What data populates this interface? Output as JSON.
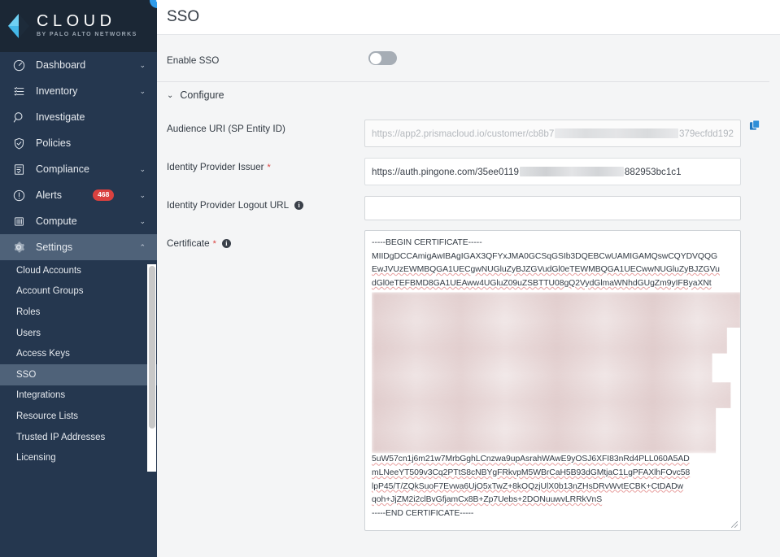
{
  "brand": {
    "word": "CLOUD",
    "tagline": "BY PALO ALTO NETWORKS",
    "logo_color": "#44b8e8",
    "sidebar_bg": "#25374f",
    "active_bg": "#4f6279"
  },
  "sidebar": {
    "collapse_icon": "chevron-left-icon",
    "items": [
      {
        "label": "Dashboard",
        "icon": "gauge-icon",
        "chevron": "⌄",
        "badge": null,
        "active": false
      },
      {
        "label": "Inventory",
        "icon": "list-icon",
        "chevron": "⌄",
        "badge": null,
        "active": false
      },
      {
        "label": "Investigate",
        "icon": "search-icon",
        "chevron": "",
        "badge": null,
        "active": false
      },
      {
        "label": "Policies",
        "icon": "shield-icon",
        "chevron": "",
        "badge": null,
        "active": false
      },
      {
        "label": "Compliance",
        "icon": "clipboard-icon",
        "chevron": "⌄",
        "badge": null,
        "active": false
      },
      {
        "label": "Alerts",
        "icon": "alert-icon",
        "chevron": "⌄",
        "badge": "468",
        "active": false
      },
      {
        "label": "Compute",
        "icon": "container-icon",
        "chevron": "⌄",
        "badge": null,
        "active": false
      },
      {
        "label": "Settings",
        "icon": "gear-icon",
        "chevron": "⌃",
        "badge": null,
        "active": true
      }
    ],
    "submenu": [
      {
        "label": "Cloud Accounts",
        "active": false
      },
      {
        "label": "Account Groups",
        "active": false
      },
      {
        "label": "Roles",
        "active": false
      },
      {
        "label": "Users",
        "active": false
      },
      {
        "label": "Access Keys",
        "active": false
      },
      {
        "label": "SSO",
        "active": true
      },
      {
        "label": "Integrations",
        "active": false
      },
      {
        "label": "Resource Lists",
        "active": false
      },
      {
        "label": "Trusted IP Addresses",
        "active": false
      },
      {
        "label": "Licensing",
        "active": false
      }
    ]
  },
  "header": {
    "title": "SSO"
  },
  "form": {
    "enable_sso": {
      "label": "Enable SSO",
      "state": "off"
    },
    "configure": {
      "label": "Configure",
      "chevron": "⌄",
      "expanded": true
    },
    "audience_uri": {
      "label": "Audience URI (SP Entity ID)",
      "value_prefix": "https://app2.prismacloud.io/customer/cb8b7",
      "value_suffix": "379ecfdd192",
      "readonly": true,
      "copy_icon": "copy-icon",
      "copy_icon_color": "#1f78c1"
    },
    "idp_issuer": {
      "label": "Identity Provider Issuer",
      "required": true,
      "value_prefix": "https://auth.pingone.com/35ee0119",
      "value_suffix": "882953bc1c1"
    },
    "idp_logout_url": {
      "label": "Identity Provider Logout URL",
      "info_icon": "info-icon",
      "value": "",
      "placeholder": ""
    },
    "certificate": {
      "label": "Certificate",
      "required": true,
      "info_icon": "info-icon",
      "lines_top": [
        "-----BEGIN CERTIFICATE-----",
        "MIIDgDCCAmigAwIBAgIGAX3QFYxJMA0GCSqGSIb3DQEBCwUAMIGAMQswCQYDVQQG",
        "EwJVUzEWMBQGA1UECgwNUGluZyBJZGVudGl0eTEWMBQGA1UECwwNUGluZyBJZGVu",
        "dGl0eTEFBMD8GA1UEAww4UGluZ09uZSBTTU08gQ2VydGlmaWNhdGUgZm9yIFByaXNt"
      ],
      "lines_bottom": [
        "5uW57cn1j6m21w7MrbGghLCnzwa9upAsrahWAwE9yOSJ6XFI83nRd4PLL060A5AD",
        "mLNeeYT509v3Cq2PTtS8cNBYgFRkvpM5WBrCaH5B93dGMtjaC1LgPFAXlhFOvc58",
        "lpP45/T/ZQkSuoF7Evwa6UjO5xTwZ+8kOQzjUlX0b13nZHsDRvWvtECBK+CtDADw",
        "qoh+JjZM2i2clBvGfjamCx8B+Zp7Uebs+2DONuuwvLRRkVnS",
        "-----END CERTIFICATE-----"
      ],
      "redacted_block": true
    }
  }
}
